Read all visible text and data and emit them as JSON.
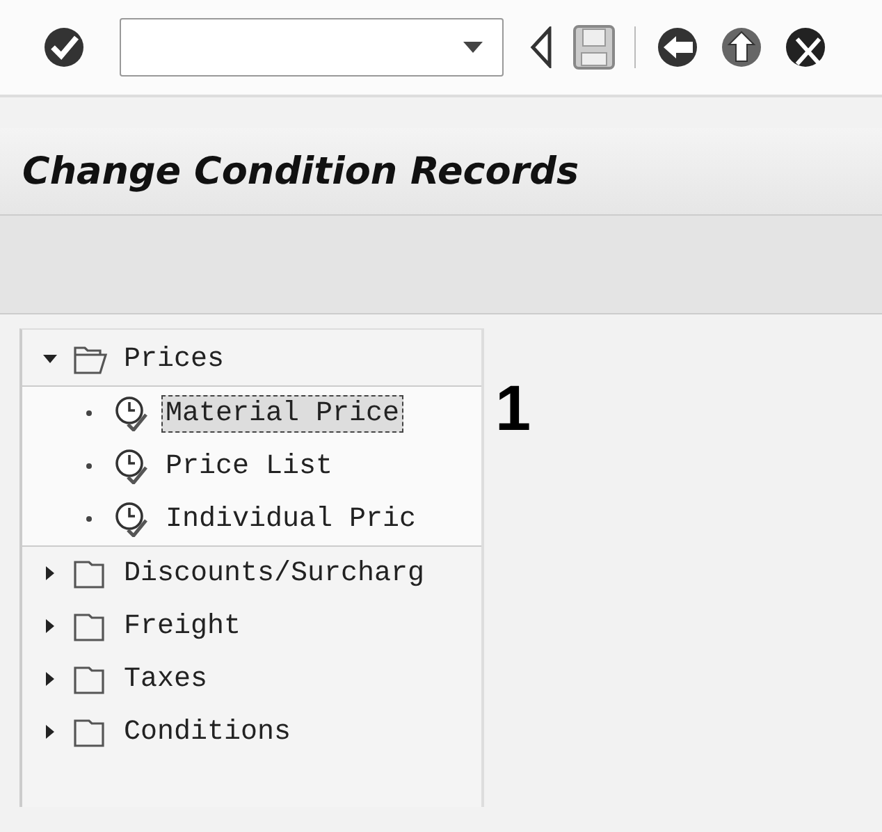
{
  "title": "Change Condition Records",
  "tree": [
    {
      "kind": "folder",
      "label": "Prices",
      "expanded": true,
      "selected": false,
      "children": [
        {
          "kind": "leaf",
          "label": "Material Price",
          "selected": true
        },
        {
          "kind": "leaf",
          "label": "Price List",
          "selected": false
        },
        {
          "kind": "leaf",
          "label": "Individual Pric",
          "selected": false
        }
      ]
    },
    {
      "kind": "folder",
      "label": "Discounts/Surcharg",
      "expanded": false,
      "selected": false
    },
    {
      "kind": "folder",
      "label": "Freight",
      "expanded": false,
      "selected": false
    },
    {
      "kind": "folder",
      "label": "Taxes",
      "expanded": false,
      "selected": false
    },
    {
      "kind": "folder",
      "label": "Conditions",
      "expanded": false,
      "selected": false
    }
  ],
  "callout": "1"
}
